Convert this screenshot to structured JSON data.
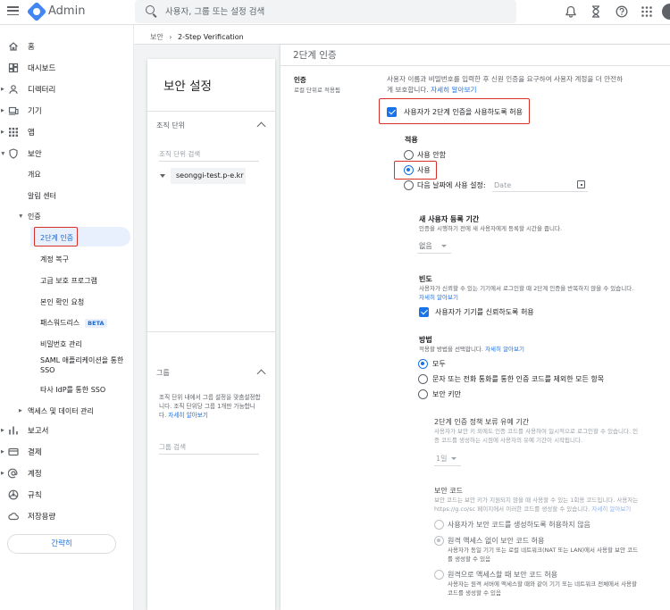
{
  "app": {
    "name": "Admin"
  },
  "search": {
    "placeholder": "사용자, 그룹 또는 설정 검색"
  },
  "sidebar": {
    "items": [
      {
        "label": "홈",
        "icon": "home-icon"
      },
      {
        "label": "대시보드",
        "icon": "dashboard-icon"
      },
      {
        "label": "디렉터리",
        "icon": "person-icon"
      },
      {
        "label": "기기",
        "icon": "devices-icon"
      },
      {
        "label": "앱",
        "icon": "apps-grid-icon"
      },
      {
        "label": "보안",
        "icon": "shield-icon"
      }
    ],
    "security_sub": [
      "개요",
      "알림 센터"
    ],
    "auth_group": "인증",
    "auth_sub": [
      "2단계 인증",
      "계정 복구",
      "고급 보호 프로그램",
      "본인 확인 요청",
      "패스워드리스",
      "비밀번호 관리",
      "SAML 애플리케이션을 통한 SSO",
      "타사 IdP를 통한 SSO"
    ],
    "beta": "BETA",
    "access_data": "액세스 및 데이터 관리",
    "bottom_items": [
      {
        "label": "보고서",
        "icon": "chart-icon"
      },
      {
        "label": "결제",
        "icon": "card-icon"
      },
      {
        "label": "계정",
        "icon": "at-icon"
      },
      {
        "label": "규칙",
        "icon": "rule-icon"
      },
      {
        "label": "저장용량",
        "icon": "cloud-icon"
      }
    ],
    "shortcut": "간략히"
  },
  "breadcrumb": {
    "parent": "보안",
    "current": "2-Step Verification"
  },
  "left_panel": {
    "title": "보안 설정",
    "org_header": "조직 단위",
    "org_search_placeholder": "조직 단위 검색",
    "org_item": "seonggi-test.p-e.kr",
    "group_header": "그룹",
    "group_help": "조직 단위 내에서 그룹 설정을 맞춤설정합니다. 조직 단위당 그룹 1개만 가능합니다.",
    "group_help_link": "자세히 알아보기",
    "group_search_placeholder": "그룹 검색"
  },
  "main": {
    "title": "2단계 인증",
    "auth_label": "인증",
    "auth_sublabel": "로컬 단위로 적용됨",
    "auth_desc_1": "사용자 이름과 비밀번호를 입력한 후 신원 인증을 요구하여 사용자 계정을 더 안전하",
    "auth_desc_2": "게 보호합니다.",
    "auth_desc_link": "자세히 알아보기",
    "allow_2sv": "사용자가 2단계 인증을 사용하도록 허용",
    "enforce": {
      "title": "적용",
      "off": "사용 안함",
      "on": "사용",
      "from_date": "다음 날짜에 사용 설정:",
      "date_placeholder": "Date"
    },
    "enroll": {
      "title": "새 사용자 등록 기간",
      "desc": "인증을 시행하기 전에 새 사용자에게 등록할 시간을 줍니다.",
      "value": "없음"
    },
    "frequency": {
      "title": "빈도",
      "desc": "사용자가 신뢰할 수 있는 기기에서 로그인할 때 2단계 인증을 반복하지 않을 수 있습니다.",
      "link": "자세히 알아보기",
      "trust_device": "사용자가 기기를 신뢰하도록 허용"
    },
    "methods": {
      "title": "방법",
      "desc": "적용할 방법을 선택합니다.",
      "link": "자세히 알아보기",
      "options": [
        "모두",
        "문자 또는 전화 통화를 통한 인증 코드를 제외한 모든 항목",
        "보안 키만"
      ]
    },
    "grace": {
      "title": "2단계 인증 정책 보류 유예 기간",
      "desc_1": "사용자가 보안 키 외에도 인증 코드를 사용하여 일시적으로 로그인할 수 있습니다. 인",
      "desc_2": "증 코드를 생성하는 시점에 사용자의 유예 기간이 시작됩니다.",
      "value": "1일"
    },
    "backup": {
      "title": "보안 코드",
      "desc_1": "보안 코드는 보안 키가 지원되지 않을 때 사용할 수 있는 1회용 코드입니다. 사용자는",
      "desc_2": "https://g.co/sc 페이지에서 이러한 코드를 생성할 수 있습니다.",
      "link": "자세히 알아보기",
      "opt1": "사용자가 보안 코드를 생성하도록 허용하지 않음",
      "opt2": "원격 액세스 없이 보안 코드 허용",
      "opt2_desc_1": "사용자가 동일 기기 또는 로컬 네트워크(NAT 또는 LAN)에서 사용할 보안 코드",
      "opt2_desc_2": "를 생성할 수 있음",
      "opt3": "원격으로 액세스할 때 보안 코드 허용",
      "opt3_desc_1": "사용자는 원격 서버에 액세스할 때와 같이 기기 또는 네트워크 전체에서 사용할",
      "opt3_desc_2": "코드를 생성할 수 있음"
    }
  }
}
